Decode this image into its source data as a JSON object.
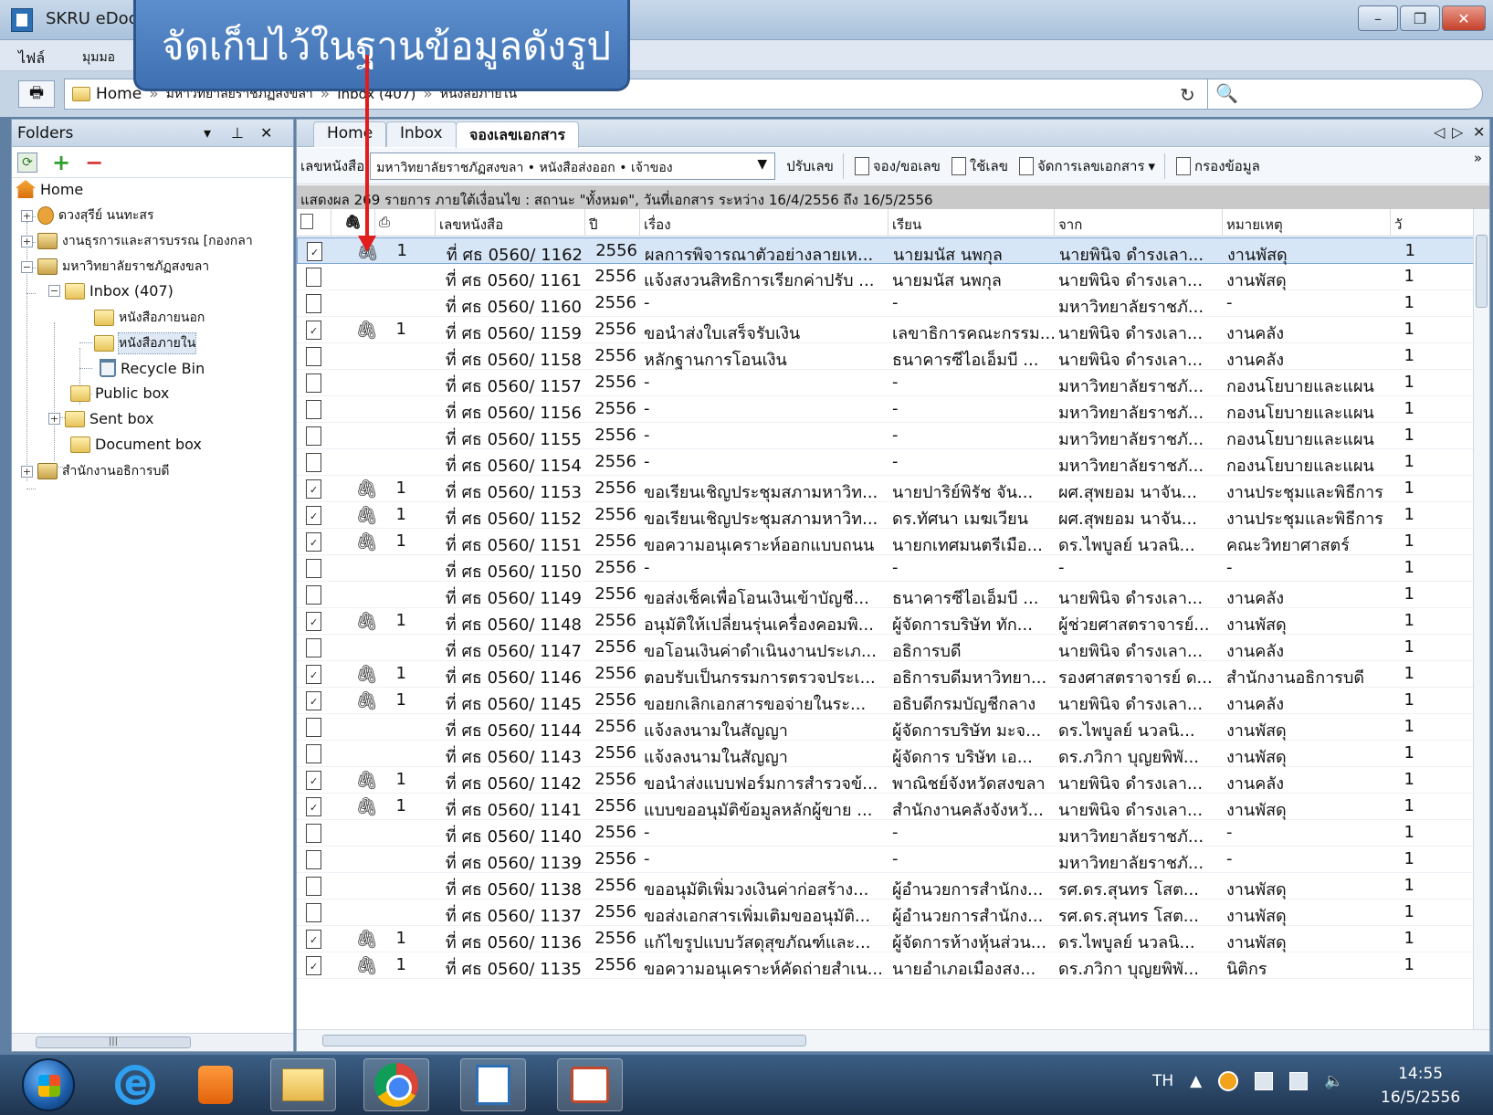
{
  "window": {
    "title": "SKRU eDoc"
  },
  "callout": {
    "text": "จัดเก็บไว้ในฐานข้อมูลดังรูป"
  },
  "menu": {
    "file": "ไฟล์",
    "view": "มุมมอ"
  },
  "breadcrumb": [
    "Home",
    "มหาวิทยาลัยราชภัฏสงขลา",
    "Inbox (407)",
    "หนังสือภายใน"
  ],
  "folders": {
    "title": "Folders",
    "tree": [
      {
        "label": "Home"
      },
      {
        "label": "ดวงสุรีย์ นนทะสร"
      },
      {
        "label": "งานธุรการและสารบรรณ [กองกลา"
      },
      {
        "label": "มหาวิทยาลัยราชภัฏสงขลา"
      },
      {
        "label": "Inbox (407)"
      },
      {
        "label": "หนังสือภายนอก"
      },
      {
        "label": "หนังสือภายใน"
      },
      {
        "label": "Recycle Bin"
      },
      {
        "label": "Public box"
      },
      {
        "label": "Sent box"
      },
      {
        "label": "Document box"
      },
      {
        "label": "สำนักงานอธิการบดี"
      }
    ]
  },
  "tabs": [
    "Home",
    "Inbox",
    "จองเลขเอกสาร"
  ],
  "toolbar": {
    "label": "เลขหนังสือ",
    "select_value": "มหาวิทยาลัยราชภัฏสงขลา • หนังสือส่งออก • เจ้าของ",
    "adjust": "ปรับเลข",
    "reserve": "จอง/ขอเลข",
    "use": "ใช้เลข",
    "manage": "จัดการเลขเอกสาร",
    "filter": "กรองข้อมูล"
  },
  "status": "แสดงผล 269 รายการ ภายใต้เงื่อนไข : สถานะ \"ทั้งหมด\", วันที่เอกสาร ระหว่าง 16/4/2556 ถึง 16/5/2556",
  "columns": {
    "doc_no": "เลขหนังสือ",
    "year": "ปี",
    "subject": "เรื่อง",
    "to": "เรียน",
    "from": "จาก",
    "note": "หมายเหตุ",
    "last": "วั"
  },
  "rows": [
    {
      "att": "1",
      "no": "ที่ ศธ 0560/ 1162",
      "year": "2556",
      "subject": "ผลการพิจารณาตัวอย่างลายเห...",
      "to": "นายมนัส นพกุล",
      "from": "นายพินิจ ดำรงเลา...",
      "note": "งานพัสดุ",
      "last": "1"
    },
    {
      "att": "",
      "no": "ที่ ศธ 0560/ 1161",
      "year": "2556",
      "subject": "แจ้งสงวนสิทธิการเรียกค่าปรับ ...",
      "to": "นายมนัส นพกุล",
      "from": "นายพินิจ ดำรงเลา...",
      "note": "งานพัสดุ",
      "last": "1"
    },
    {
      "att": "",
      "no": "ที่ ศธ 0560/ 1160",
      "year": "2556",
      "subject": "-",
      "to": "-",
      "from": "มหาวิทยาลัยราชภั...",
      "note": "-",
      "last": "1"
    },
    {
      "att": "1",
      "no": "ที่ ศธ 0560/ 1159",
      "year": "2556",
      "subject": "ขอนำส่งใบเสร็จรับเงิน",
      "to": "เลขาธิการคณะกรรม...",
      "from": "นายพินิจ ดำรงเลา...",
      "note": "งานคลัง",
      "last": "1"
    },
    {
      "att": "",
      "no": "ที่ ศธ 0560/ 1158",
      "year": "2556",
      "subject": "หลักฐานการโอนเงิน",
      "to": "ธนาคารซีไอเอ็มบี ...",
      "from": "นายพินิจ ดำรงเลา...",
      "note": "งานคลัง",
      "last": "1"
    },
    {
      "att": "",
      "no": "ที่ ศธ 0560/ 1157",
      "year": "2556",
      "subject": "-",
      "to": "-",
      "from": "มหาวิทยาลัยราชภั...",
      "note": "กองนโยบายและแผน",
      "last": "1"
    },
    {
      "att": "",
      "no": "ที่ ศธ 0560/ 1156",
      "year": "2556",
      "subject": "-",
      "to": "-",
      "from": "มหาวิทยาลัยราชภั...",
      "note": "กองนโยบายและแผน",
      "last": "1"
    },
    {
      "att": "",
      "no": "ที่ ศธ 0560/ 1155",
      "year": "2556",
      "subject": "-",
      "to": "-",
      "from": "มหาวิทยาลัยราชภั...",
      "note": "กองนโยบายและแผน",
      "last": "1"
    },
    {
      "att": "",
      "no": "ที่ ศธ 0560/ 1154",
      "year": "2556",
      "subject": "-",
      "to": "-",
      "from": "มหาวิทยาลัยราชภั...",
      "note": "กองนโยบายและแผน",
      "last": "1"
    },
    {
      "att": "1",
      "no": "ที่ ศธ 0560/ 1153",
      "year": "2556",
      "subject": "ขอเรียนเชิญประชุมสภามหาวิท...",
      "to": "นายปาริย์พิรัช จัน...",
      "from": "ผศ.สุพยอม นาจัน...",
      "note": "งานประชุมและพิธีการ",
      "last": "1"
    },
    {
      "att": "1",
      "no": "ที่ ศธ 0560/ 1152",
      "year": "2556",
      "subject": "ขอเรียนเชิญประชุมสภามหาวิท...",
      "to": "ดร.ทัศนา เมฆเวียน",
      "from": "ผศ.สุพยอม นาจัน...",
      "note": "งานประชุมและพิธีการ",
      "last": "1"
    },
    {
      "att": "1",
      "no": "ที่ ศธ 0560/ 1151",
      "year": "2556",
      "subject": "ขอความอนุเคราะห์ออกแบบถนน",
      "to": "นายกเทศมนตรีเมือ...",
      "from": "ดร.ไพบูลย์ นวลนิ...",
      "note": "คณะวิทยาศาสตร์",
      "last": "1"
    },
    {
      "att": "",
      "no": "ที่ ศธ 0560/ 1150",
      "year": "2556",
      "subject": "-",
      "to": "-",
      "from": "-",
      "note": "-",
      "last": "1"
    },
    {
      "att": "",
      "no": "ที่ ศธ 0560/ 1149",
      "year": "2556",
      "subject": "ขอส่งเช็คเพื่อโอนเงินเข้าบัญชี...",
      "to": "ธนาคารซีไอเอ็มบี ...",
      "from": "นายพินิจ ดำรงเลา...",
      "note": "งานคลัง",
      "last": "1"
    },
    {
      "att": "1",
      "no": "ที่ ศธ 0560/ 1148",
      "year": "2556",
      "subject": "อนุมัติให้เปลี่ยนรุ่นเครื่องคอมพิ...",
      "to": "ผู้จัดการบริษัท ทัก...",
      "from": "ผู้ช่วยศาสตราจารย์...",
      "note": "งานพัสดุ",
      "last": "1"
    },
    {
      "att": "",
      "no": "ที่ ศธ 0560/ 1147",
      "year": "2556",
      "subject": "ขอโอนเงินค่าดำเนินงานประเภ...",
      "to": "อธิการบดี",
      "from": "นายพินิจ ดำรงเลา...",
      "note": "งานคลัง",
      "last": "1"
    },
    {
      "att": "1",
      "no": "ที่ ศธ 0560/ 1146",
      "year": "2556",
      "subject": "ตอบรับเป็นกรรมการตรวจประเ...",
      "to": "อธิการบดีมหาวิทยา...",
      "from": "รองศาสตราจารย์ ด...",
      "note": "สำนักงานอธิการบดี",
      "last": "1"
    },
    {
      "att": "1",
      "no": "ที่ ศธ 0560/ 1145",
      "year": "2556",
      "subject": "ขอยกเลิกเอกสารขอจ่ายในระ...",
      "to": "อธิบดีกรมบัญชีกลาง",
      "from": "นายพินิจ ดำรงเลา...",
      "note": "งานคลัง",
      "last": "1"
    },
    {
      "att": "",
      "no": "ที่ ศธ 0560/ 1144",
      "year": "2556",
      "subject": "แจ้งลงนามในสัญญา",
      "to": "ผู้จัดการบริษัท มะจ...",
      "from": "ดร.ไพบูลย์ นวลนิ...",
      "note": "งานพัสดุ",
      "last": "1"
    },
    {
      "att": "",
      "no": "ที่ ศธ 0560/ 1143",
      "year": "2556",
      "subject": "แจ้งลงนามในสัญญา",
      "to": "ผู้จัดการ บริษัท เอ...",
      "from": "ดร.ภวิกา บุญยพิพั...",
      "note": "งานพัสดุ",
      "last": "1"
    },
    {
      "att": "1",
      "no": "ที่ ศธ 0560/ 1142",
      "year": "2556",
      "subject": "ขอนำส่งแบบฟอร์มการสำรวจข้...",
      "to": "พาณิชย์จังหวัดสงขลา",
      "from": "นายพินิจ ดำรงเลา...",
      "note": "งานคลัง",
      "last": "1"
    },
    {
      "att": "1",
      "no": "ที่ ศธ 0560/ 1141",
      "year": "2556",
      "subject": "แบบขออนุมัติข้อมูลหลักผู้ขาย ...",
      "to": "สำนักงานคลังจังหวั...",
      "from": "นายพินิจ ดำรงเลา...",
      "note": "งานพัสดุ",
      "last": "1"
    },
    {
      "att": "",
      "no": "ที่ ศธ 0560/ 1140",
      "year": "2556",
      "subject": "-",
      "to": "-",
      "from": "มหาวิทยาลัยราชภั...",
      "note": "-",
      "last": "1"
    },
    {
      "att": "",
      "no": "ที่ ศธ 0560/ 1139",
      "year": "2556",
      "subject": "-",
      "to": "-",
      "from": "มหาวิทยาลัยราชภั...",
      "note": "-",
      "last": "1"
    },
    {
      "att": "",
      "no": "ที่ ศธ 0560/ 1138",
      "year": "2556",
      "subject": "ขออนุมัติเพิ่มวงเงินค่าก่อสร้าง...",
      "to": "ผู้อำนวยการสำนักง...",
      "from": "รศ.ดร.สุนทร โสต...",
      "note": "งานพัสดุ",
      "last": "1"
    },
    {
      "att": "",
      "no": "ที่ ศธ 0560/ 1137",
      "year": "2556",
      "subject": "ขอส่งเอกสารเพิ่มเติมขออนุมัติ...",
      "to": "ผู้อำนวยการสำนักง...",
      "from": "รศ.ดร.สุนทร โสต...",
      "note": "งานพัสดุ",
      "last": "1"
    },
    {
      "att": "1",
      "no": "ที่ ศธ 0560/ 1136",
      "year": "2556",
      "subject": "แก้ไขรูปแบบวัสดุสุขภัณฑ์และ...",
      "to": "ผู้จัดการห้างหุ้นส่วน...",
      "from": "ดร.ไพบูลย์ นวลนิ...",
      "note": "งานพัสดุ",
      "last": "1"
    },
    {
      "att": "1",
      "no": "ที่ ศธ 0560/ 1135",
      "year": "2556",
      "subject": "ขอความอนุเคราะห์คัดถ่ายสำเน...",
      "to": "นายอำเภอเมืองสง...",
      "from": "ดร.ภวิกา บุญยพิพั...",
      "note": "นิติกร",
      "last": "1"
    }
  ],
  "tray": {
    "lang": "TH",
    "time": "14:55",
    "date": "16/5/2556"
  }
}
